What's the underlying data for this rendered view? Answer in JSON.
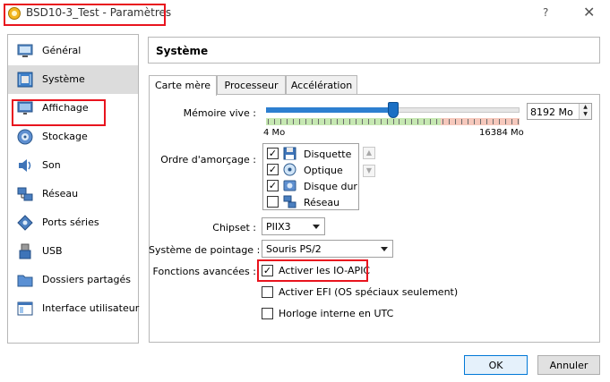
{
  "window": {
    "title": "BSD10-3_Test - Paramètres",
    "help": "?",
    "close": "✕"
  },
  "sidebar": {
    "items": [
      {
        "label": "Général",
        "icon": "monitor-icon"
      },
      {
        "label": "Système",
        "icon": "system-board-icon"
      },
      {
        "label": "Affichage",
        "icon": "display-icon"
      },
      {
        "label": "Stockage",
        "icon": "disk-icon"
      },
      {
        "label": "Son",
        "icon": "speaker-icon"
      },
      {
        "label": "Réseau",
        "icon": "network-icon"
      },
      {
        "label": "Ports séries",
        "icon": "serial-port-icon"
      },
      {
        "label": "USB",
        "icon": "usb-icon"
      },
      {
        "label": "Dossiers partagés",
        "icon": "folder-icon"
      },
      {
        "label": "Interface utilisateur",
        "icon": "ui-window-icon"
      }
    ],
    "active_index": 1
  },
  "section": {
    "title": "Système"
  },
  "tabs": [
    {
      "label": "Carte mère",
      "active": true
    },
    {
      "label": "Processeur",
      "active": false
    },
    {
      "label": "Accélération",
      "active": false
    }
  ],
  "motherboard": {
    "memory": {
      "label": "Mémoire vive :",
      "value": "8192 Mo",
      "min_label": "4 Mo",
      "max_label": "16384 Mo",
      "fraction": 0.5
    },
    "boot_order": {
      "label": "Ordre d'amorçage :",
      "items": [
        {
          "label": "Disquette",
          "checked": true,
          "icon": "floppy-icon"
        },
        {
          "label": "Optique",
          "checked": true,
          "icon": "optical-disc-icon"
        },
        {
          "label": "Disque dur",
          "checked": true,
          "icon": "hard-disk-icon"
        },
        {
          "label": "Réseau",
          "checked": false,
          "icon": "network-icon"
        }
      ]
    },
    "chipset": {
      "label": "Chipset :",
      "value": "PIIX3"
    },
    "pointing": {
      "label": "Système de pointage :",
      "value": "Souris PS/2"
    },
    "features": {
      "label": "Fonctions avancées :",
      "options": [
        {
          "label": "Activer les IO-APIC",
          "checked": true
        },
        {
          "label": "Activer EFI (OS spéciaux seulement)",
          "checked": false
        },
        {
          "label": "Horloge interne en UTC",
          "checked": false
        }
      ]
    }
  },
  "buttons": {
    "ok": "OK",
    "cancel": "Annuler"
  },
  "colors": {
    "highlight": "#e8141e",
    "accent": "#1a6fc4",
    "safe_zone": "#c6e8b2",
    "warn_zone": "#f6c8bc"
  }
}
